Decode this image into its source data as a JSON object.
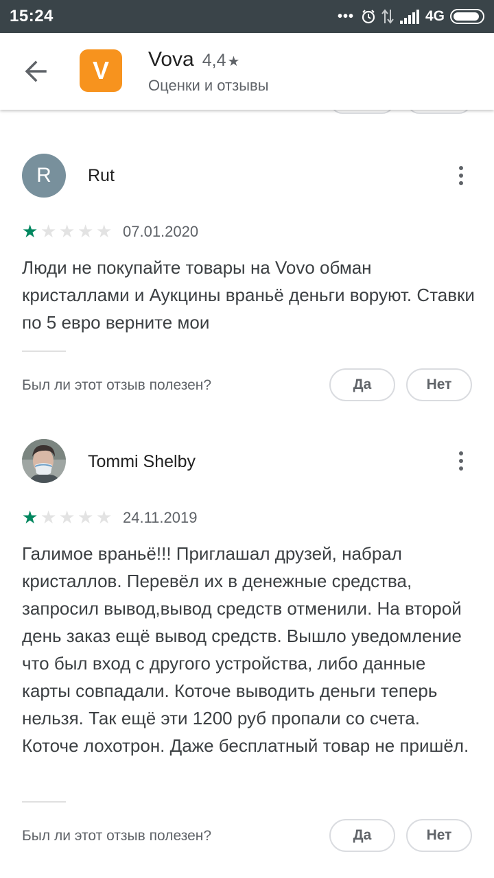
{
  "status_bar": {
    "time": "15:24",
    "dots": "•••",
    "network": "4G",
    "icons": [
      "alarm-icon",
      "data-transfer-icon",
      "signal-icon",
      "battery-icon"
    ]
  },
  "header": {
    "back_icon": "arrow-back-icon",
    "app_icon_letter": "V",
    "app_name": "Vova",
    "rating": "4,4",
    "rating_star": "★",
    "subtitle": "Оценки и отзывы",
    "accent_color": "#f7931e"
  },
  "reviews": [
    {
      "avatar_letter": "R",
      "author": "Rut",
      "rating": 1,
      "date": "07.01.2020",
      "text": "Люди не покупайте товары на Vovo обман кристаллами и Аукцины враньё деньги воруют. Ставки по 5 евро верните мои",
      "helpful_question": "Был ли этот отзыв полезен?",
      "yes_label": "Да",
      "no_label": "Нет"
    },
    {
      "avatar_letter": "",
      "author": "Tommi Shelby",
      "rating": 1,
      "date": "24.11.2019",
      "text": "Галимое враньё!!! Приглашал друзей, набрал кристаллов. Перевёл их в денежные средства, запросил вывод,вывод средств отменили. На второй день заказ ещё вывод средств. Вышло уведомление что был вход с другого устройства, либо данные карты совпадали. Коточе выводить деньги теперь нельзя. Так ещё эти 1200 руб пропали со счета. Коточе лохотрон. Даже бесплатный товар не пришёл.",
      "helpful_question": "Был ли этот отзыв полезен?",
      "yes_label": "Да",
      "no_label": "Нет"
    }
  ],
  "colors": {
    "star_filled": "#01875f",
    "star_empty": "#e3e3e3",
    "status_bar": "#3a4449"
  }
}
